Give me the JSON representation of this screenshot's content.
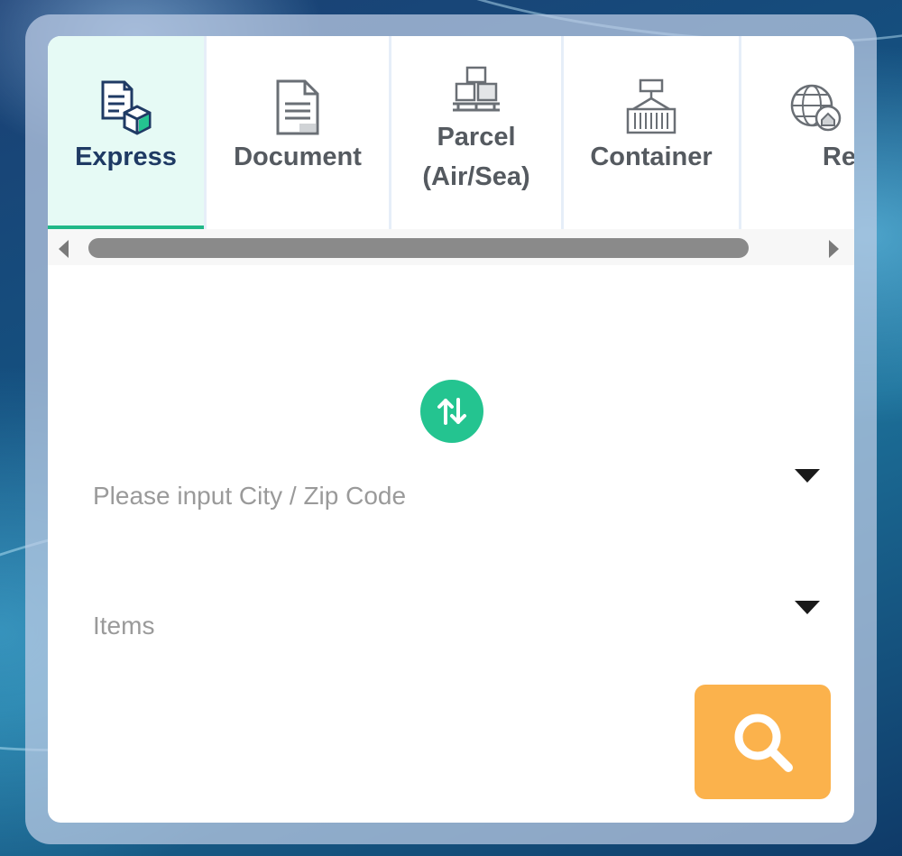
{
  "tabs": [
    {
      "label": "Express",
      "icon": "express-icon",
      "active": true
    },
    {
      "label": "Document",
      "icon": "document-icon",
      "active": false
    },
    {
      "label_line1": "Parcel",
      "label_line2": "(Air/Sea)",
      "icon": "parcel-icon",
      "active": false
    },
    {
      "label": "Container",
      "icon": "container-icon",
      "active": false
    },
    {
      "label": "Relocation",
      "icon": "relocation-icon",
      "active": false
    }
  ],
  "form": {
    "location_placeholder": "Please input City / Zip Code",
    "items_placeholder": "Items"
  },
  "colors": {
    "accent_green": "#24c490",
    "active_tab_bg": "#e6faf5",
    "active_tab_text": "#1f3a64",
    "search_orange": "#fbb24c"
  }
}
